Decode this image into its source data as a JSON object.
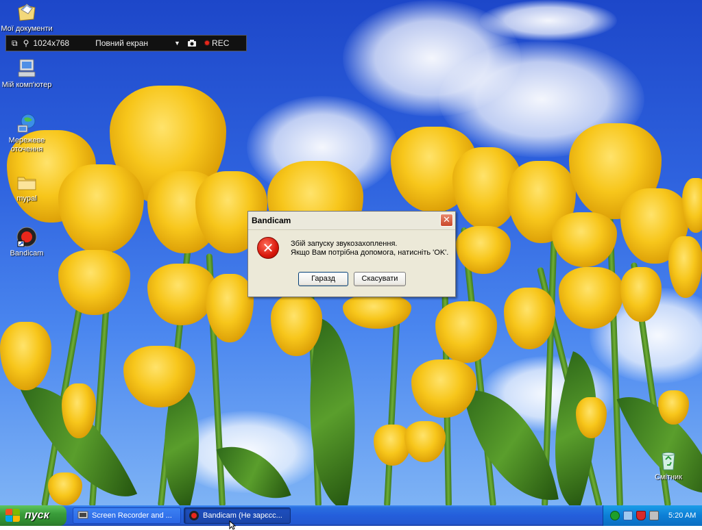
{
  "desktop": {
    "icons": [
      {
        "label": "Мої документи",
        "icon": "my-documents-icon"
      },
      {
        "label": "Мій комп'ютер",
        "icon": "my-computer-icon"
      },
      {
        "label": "Мережеве оточення",
        "icon": "network-places-icon"
      },
      {
        "label": "mypal",
        "icon": "folder-icon"
      },
      {
        "label": "Bandicam",
        "icon": "bandicam-icon"
      },
      {
        "label": "Смітник",
        "icon": "recycle-bin-icon"
      }
    ]
  },
  "recorder_bar": {
    "resolution": "1024x768",
    "mode": "Повний екран",
    "rec_label": "REC"
  },
  "dialog": {
    "title": "Bandicam",
    "close_glyph": "✕",
    "message_line1": "Збій запуску звукозахоплення.",
    "message_line2": "Якщо Вам потрібна допомога, натисніть 'OK'.",
    "ok_label": "Гаразд",
    "cancel_label": "Скасувати"
  },
  "taskbar": {
    "start_label": "пуск",
    "tasks": [
      {
        "label": "Screen Recorder and ...",
        "icon": "screen-recorder-icon",
        "active": false
      },
      {
        "label": "Bandicam (Не зарєсс...",
        "icon": "bandicam-icon",
        "active": true
      }
    ],
    "clock": "5:20 AM"
  },
  "colors": {
    "taskbar_blue": "#245edb",
    "start_green": "#3a9d3a",
    "dialog_bg": "#ece9d8",
    "error_red": "#d8180c"
  }
}
